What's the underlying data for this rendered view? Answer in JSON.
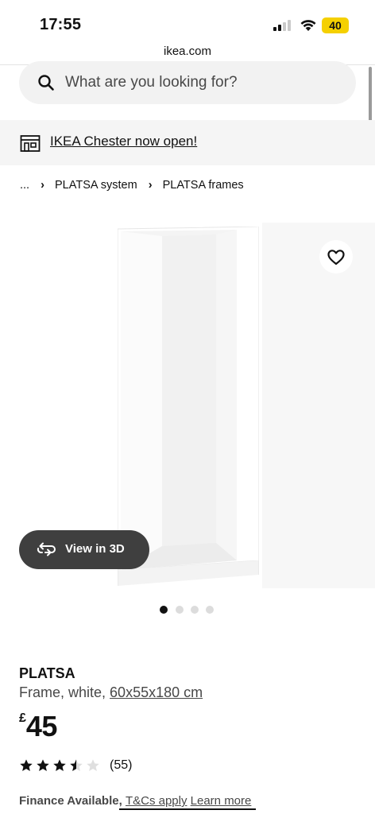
{
  "status_bar": {
    "time": "17:55",
    "battery": "40",
    "icons": [
      "signal-icon",
      "wifi-icon",
      "battery-icon"
    ],
    "battery_color": "#f5d000"
  },
  "browser": {
    "url": "ikea.com"
  },
  "search": {
    "placeholder": "What are you looking for?",
    "icon": "search-icon"
  },
  "banner": {
    "text": "IKEA Chester now open!",
    "icon": "store-icon"
  },
  "breadcrumb": {
    "items": [
      "...",
      "PLATSA system",
      "PLATSA frames"
    ]
  },
  "gallery": {
    "view_3d_label": "View in 3D",
    "image_count": 4,
    "active_index": 0,
    "wishlist_icon": "heart-icon"
  },
  "product": {
    "name": "PLATSA",
    "description": "Frame, white,",
    "size": "60x55x180 cm",
    "currency": "£",
    "price": "45",
    "rating": 3.5,
    "rating_max": 5,
    "review_count": "(55)",
    "finance_label": "Finance Available,",
    "finance_links": [
      "T&Cs apply",
      "Learn more"
    ]
  },
  "colors": {
    "text": "#111111",
    "secondary_text": "#484848",
    "search_bg": "#f2f2f2",
    "banner_bg": "#f5f5f5",
    "view3d_bg": "#3f3f3f"
  }
}
